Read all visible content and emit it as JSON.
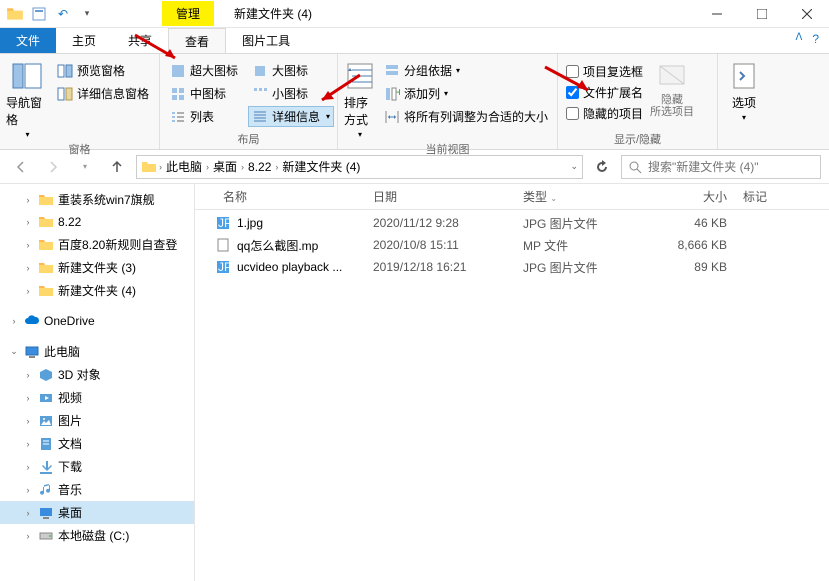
{
  "titlebar": {
    "manage": "管理",
    "title": "新建文件夹 (4)"
  },
  "tabs": {
    "file": "文件",
    "home": "主页",
    "share": "共享",
    "view": "查看",
    "pictools": "图片工具"
  },
  "ribbon": {
    "group_pane": "窗格",
    "nav_pane": "导航窗格",
    "preview_pane": "预览窗格",
    "details_pane": "详细信息窗格",
    "group_layout": "布局",
    "xl_icons": "超大图标",
    "l_icons": "大图标",
    "m_icons": "中图标",
    "s_icons": "小图标",
    "list": "列表",
    "details": "详细信息",
    "group_curview": "当前视图",
    "sort": "排序方式",
    "groupby": "分组依据",
    "addcol": "添加列",
    "fitcols": "将所有列调整为合适的大小",
    "group_showhide": "显示/隐藏",
    "chk_checkboxes": "项目复选框",
    "chk_ext": "文件扩展名",
    "chk_hidden": "隐藏的项目",
    "hide_sel": "隐藏\n所选项目",
    "options": "选项"
  },
  "breadcrumb": [
    "此电脑",
    "桌面",
    "8.22",
    "新建文件夹 (4)"
  ],
  "search_placeholder": "搜索\"新建文件夹 (4)\"",
  "tree": {
    "items1": [
      "重装系统win7旗舰",
      "8.22",
      "百度8.20新规则自查登",
      "新建文件夹 (3)",
      "新建文件夹 (4)"
    ],
    "onedrive": "OneDrive",
    "thispc": "此电脑",
    "pc_items": [
      "3D 对象",
      "视频",
      "图片",
      "文档",
      "下载",
      "音乐",
      "桌面",
      "本地磁盘 (C:)"
    ]
  },
  "columns": {
    "name": "名称",
    "date": "日期",
    "type": "类型",
    "size": "大小",
    "tag": "标记"
  },
  "files": [
    {
      "name": "1.jpg",
      "date": "2020/11/12 9:28",
      "type": "JPG 图片文件",
      "size": "46 KB",
      "icon": "jpg"
    },
    {
      "name": "qq怎么截图.mp",
      "date": "2020/10/8 15:11",
      "type": "MP 文件",
      "size": "8,666 KB",
      "icon": "file"
    },
    {
      "name": "ucvideo playback ...",
      "date": "2019/12/18 16:21",
      "type": "JPG 图片文件",
      "size": "89 KB",
      "icon": "jpg"
    }
  ]
}
